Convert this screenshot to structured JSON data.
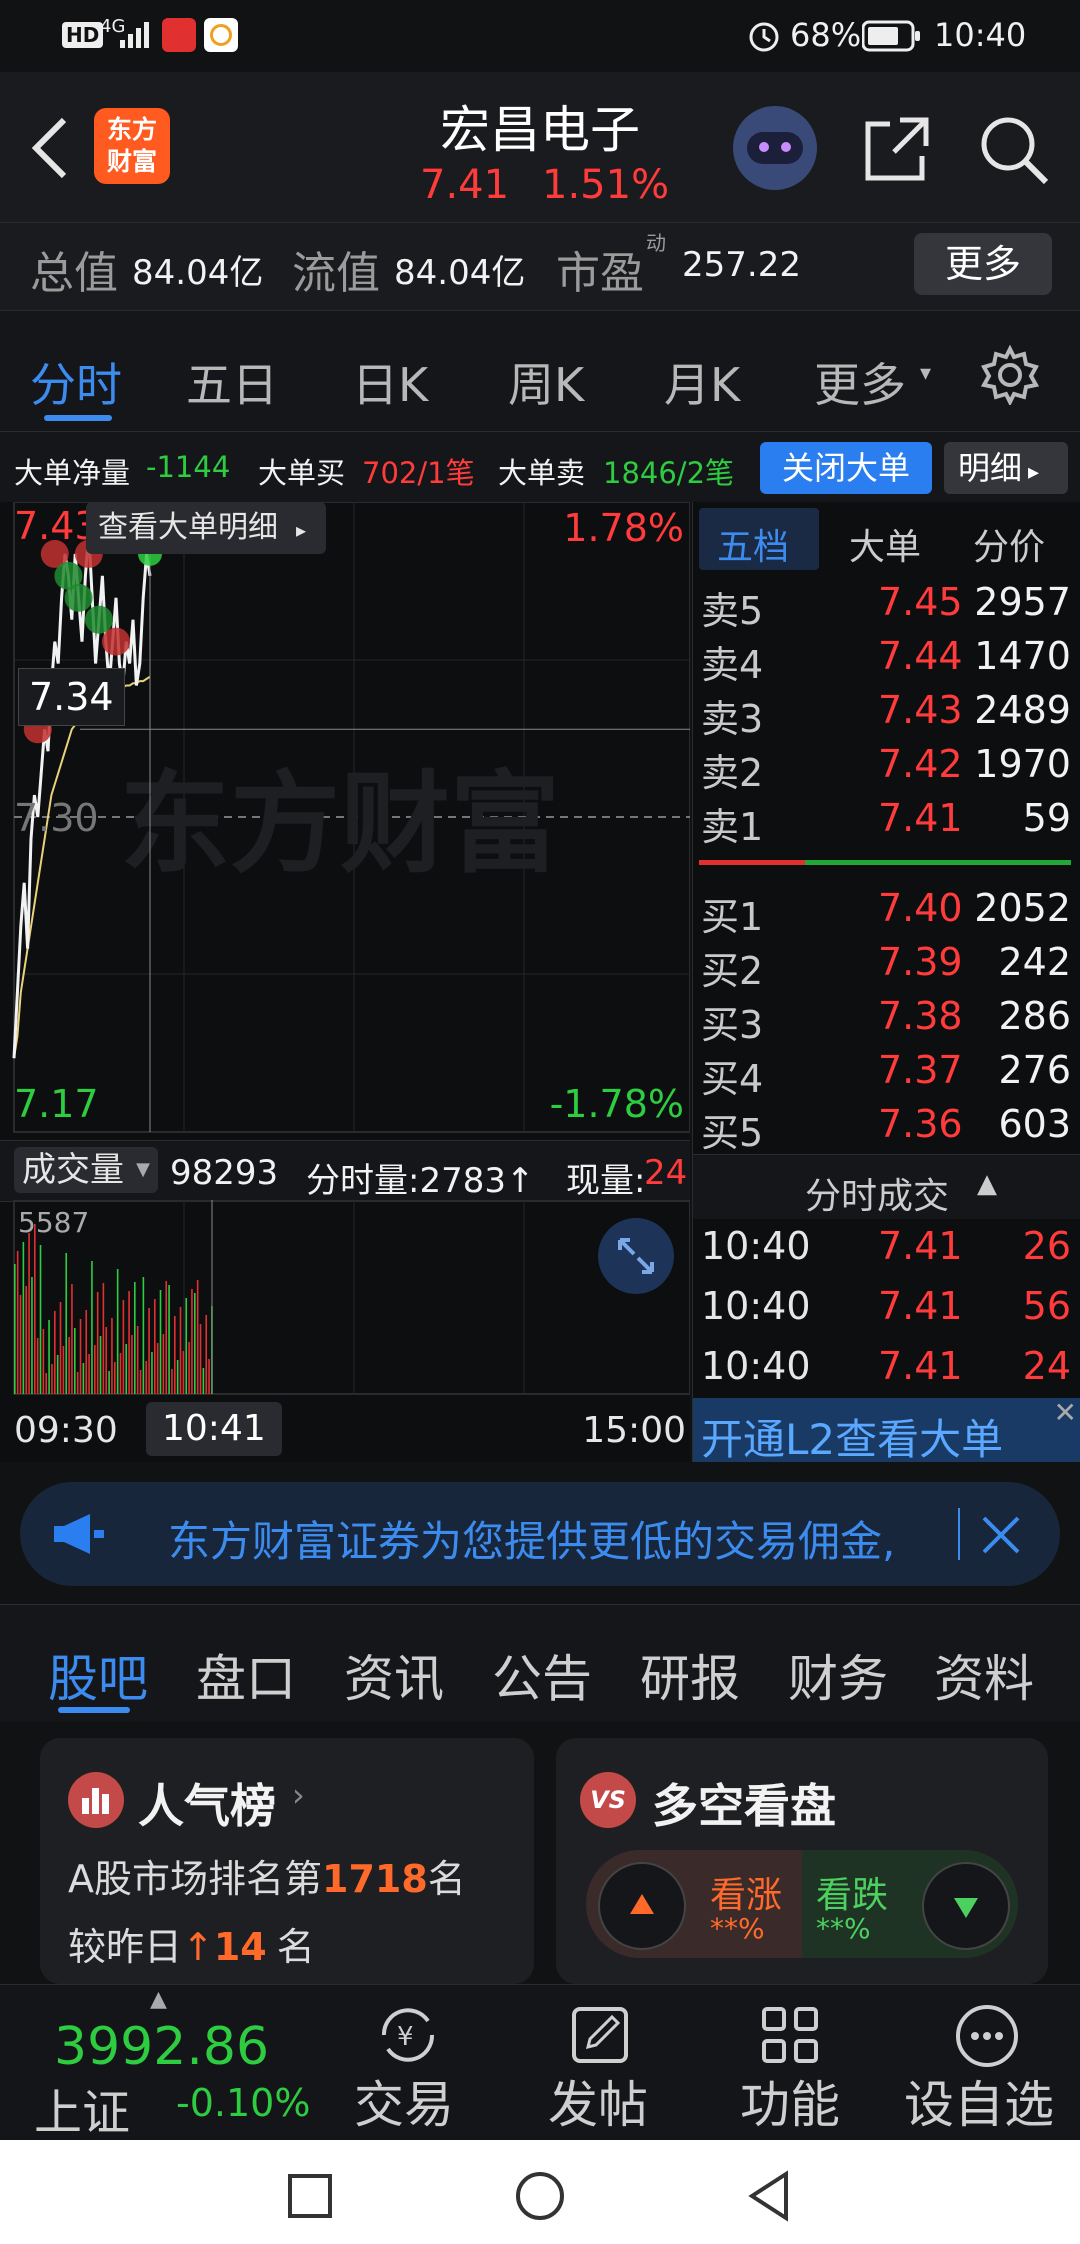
{
  "status_bar": {
    "hd": "HD",
    "net": "4G",
    "battery_pct": "68%",
    "time": "10:40"
  },
  "header": {
    "logo_line1": "东方",
    "logo_line2": "财富",
    "stock_name": "宏昌电子",
    "price": "7.41",
    "change_pct": "1.51%"
  },
  "quick_info": {
    "total_label": "总值",
    "total_value": "84.04亿",
    "float_label": "流值",
    "float_value": "84.04亿",
    "pe_label": "市盈",
    "pe_sup": "动",
    "pe_value": "257.22",
    "more_button": "更多"
  },
  "tabs": [
    "分时",
    "五日",
    "日K",
    "周K",
    "月K",
    "更多"
  ],
  "big_orders": {
    "net_label": "大单净量",
    "net_value": "-1144",
    "buy_label": "大单买",
    "buy_value": "702/1笔",
    "sell_label": "大单卖",
    "sell_value": "1846/2笔",
    "close_button": "关闭大单",
    "detail_button": "明细"
  },
  "chart": {
    "tooltip": "查看大单明细",
    "price_high": "7.43",
    "pct_high": "1.78%",
    "crosshair_price": "7.34",
    "price_mid": "7.30",
    "price_low": "7.17",
    "pct_low": "-1.78%",
    "watermark": "东方财富",
    "volume_label": "成交量",
    "volume_value": "98293",
    "minute_volume": "分时量:2783↑",
    "current_volume_label": "现量:",
    "current_volume_value": "24",
    "vol_max": "5587",
    "time_start": "09:30",
    "time_cursor": "10:41",
    "time_end": "15:00",
    "price_line": [
      7.19,
      7.22,
      7.25,
      7.27,
      7.24,
      7.29,
      7.31,
      7.3,
      7.32,
      7.34,
      7.33,
      7.36,
      7.38,
      7.37,
      7.4,
      7.42,
      7.41,
      7.39,
      7.42,
      7.4,
      7.38,
      7.41,
      7.43,
      7.4,
      7.37,
      7.39,
      7.41,
      7.38,
      7.36,
      7.38,
      7.4,
      7.37,
      7.36,
      7.38,
      7.37,
      7.39,
      7.36,
      7.37,
      7.4,
      7.42,
      7.41
    ],
    "avg_line": [
      7.19,
      7.2,
      7.22,
      7.23,
      7.24,
      7.25,
      7.26,
      7.27,
      7.28,
      7.29,
      7.3,
      7.31,
      7.315,
      7.32,
      7.325,
      7.33,
      7.335,
      7.34,
      7.342,
      7.344,
      7.346,
      7.348,
      7.35,
      7.351,
      7.352,
      7.353,
      7.354,
      7.355,
      7.356,
      7.357,
      7.358,
      7.359,
      7.359,
      7.36,
      7.36,
      7.361,
      7.361,
      7.362,
      7.362,
      7.363,
      7.364
    ]
  },
  "order_book": {
    "tabs": [
      "五档",
      "大单",
      "分价"
    ],
    "asks": [
      {
        "label": "卖5",
        "price": "7.45",
        "vol": "2957"
      },
      {
        "label": "卖4",
        "price": "7.44",
        "vol": "1470"
      },
      {
        "label": "卖3",
        "price": "7.43",
        "vol": "2489"
      },
      {
        "label": "卖2",
        "price": "7.42",
        "vol": "1970"
      },
      {
        "label": "卖1",
        "price": "7.41",
        "vol": "59"
      }
    ],
    "bids": [
      {
        "label": "买1",
        "price": "7.40",
        "vol": "2052"
      },
      {
        "label": "买2",
        "price": "7.39",
        "vol": "242"
      },
      {
        "label": "买3",
        "price": "7.38",
        "vol": "286"
      },
      {
        "label": "买4",
        "price": "7.37",
        "vol": "276"
      },
      {
        "label": "买5",
        "price": "7.36",
        "vol": "603"
      }
    ],
    "trades_title": "分时成交",
    "trades": [
      {
        "time": "10:40",
        "price": "7.41",
        "vol": "26"
      },
      {
        "time": "10:40",
        "price": "7.41",
        "vol": "56"
      },
      {
        "time": "10:40",
        "price": "7.41",
        "vol": "24"
      }
    ],
    "l2_promo": "开通L2查看大单"
  },
  "banner": {
    "text": "东方财富证券为您提供更低的交易佣金,"
  },
  "bottom_tabs": [
    "股吧",
    "盘口",
    "资讯",
    "公告",
    "研报",
    "财务",
    "资料"
  ],
  "popularity": {
    "title": "人气榜",
    "rank_prefix": "A股市场排名第",
    "rank": "1718",
    "rank_suffix": "名",
    "change_prefix": "较昨日",
    "change_arrow": "↑",
    "change": "14",
    "change_suffix": "名"
  },
  "sentiment": {
    "title": "多空看盘",
    "badge": "VS",
    "up_label": "看涨",
    "up_pct": "**%",
    "down_label": "看跌",
    "down_pct": "**%"
  },
  "bottom_nav": {
    "index_value": "3992.86",
    "index_name": "上证",
    "index_change": "-0.10%",
    "trade": "交易",
    "trade_icon": "¥",
    "post": "发帖",
    "function": "功能",
    "watchlist": "设自选"
  },
  "colors": {
    "up": "#ff3b3b",
    "down": "#2ecc40",
    "accent": "#3c8cf0",
    "brand": "#ff5a1f"
  }
}
